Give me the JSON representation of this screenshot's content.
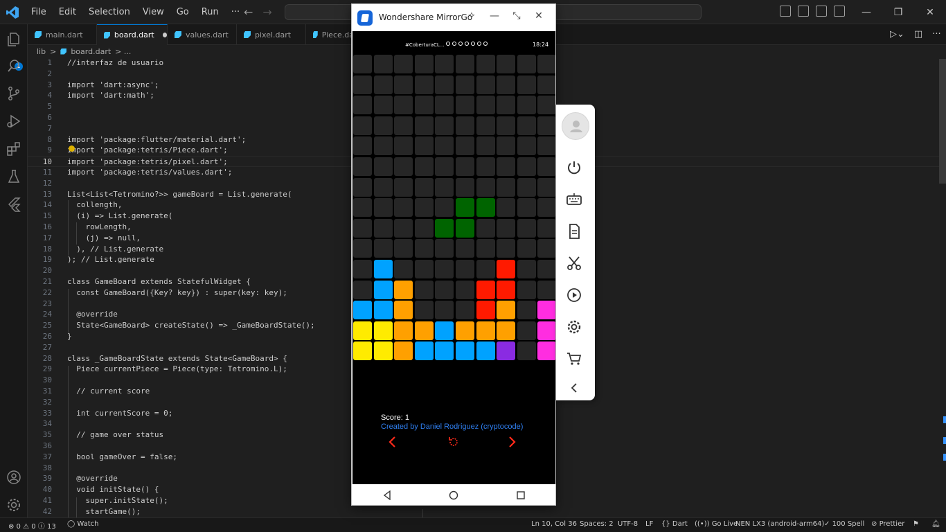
{
  "window": {
    "menu": [
      "File",
      "Edit",
      "Selection",
      "View",
      "Go",
      "Run",
      "···"
    ]
  },
  "activity": {
    "source_control_badge": "1"
  },
  "tabs": [
    {
      "label": "main.dart",
      "active": false
    },
    {
      "label": "board.dart",
      "active": true,
      "modified": true
    },
    {
      "label": "values.dart",
      "active": false
    },
    {
      "label": "pixel.dart",
      "active": false
    },
    {
      "label": "Piece.da",
      "active": false
    }
  ],
  "breadcrumb": {
    "folder": "lib",
    "sep": ">",
    "file": "board.dart",
    "tail": "> ..."
  },
  "editor": {
    "current_line": 10,
    "lines": [
      {
        "n": "1",
        "t": "//interfaz de usuario"
      },
      {
        "n": "2",
        "t": ""
      },
      {
        "n": "3",
        "t": "import 'dart:async';"
      },
      {
        "n": "4",
        "t": "import 'dart:math';"
      },
      {
        "n": "5",
        "t": ""
      },
      {
        "n": "6",
        "t": ""
      },
      {
        "n": "7",
        "t": ""
      },
      {
        "n": "8",
        "t": "import 'package:flutter/material.dart';"
      },
      {
        "n": "9",
        "t": "import 'package:tetris/Piece.dart';"
      },
      {
        "n": "10",
        "t": "import 'package:tetris/pixel.dart';"
      },
      {
        "n": "11",
        "t": "import 'package:tetris/values.dart';"
      },
      {
        "n": "12",
        "t": ""
      },
      {
        "n": "13",
        "t": "List<List<Tetromino?>> gameBoard = List.generate("
      },
      {
        "n": "14",
        "t": "  collength,"
      },
      {
        "n": "15",
        "t": "  (i) => List.generate("
      },
      {
        "n": "16",
        "t": "    rowLength,"
      },
      {
        "n": "17",
        "t": "    (j) => null,"
      },
      {
        "n": "18",
        "t": "  ), // List.generate"
      },
      {
        "n": "19",
        "t": "); // List.generate"
      },
      {
        "n": "20",
        "t": ""
      },
      {
        "n": "21",
        "t": "class GameBoard extends StatefulWidget {"
      },
      {
        "n": "22",
        "t": "  const GameBoard({Key? key}) : super(key: key);"
      },
      {
        "n": "23",
        "t": ""
      },
      {
        "n": "24",
        "t": "  @override"
      },
      {
        "n": "25",
        "t": "  State<GameBoard> createState() => _GameBoardState();"
      },
      {
        "n": "26",
        "t": "}"
      },
      {
        "n": "27",
        "t": ""
      },
      {
        "n": "28",
        "t": "class _GameBoardState extends State<GameBoard> {"
      },
      {
        "n": "29",
        "t": "  Piece currentPiece = Piece(type: Tetromino.L);"
      },
      {
        "n": "30",
        "t": ""
      },
      {
        "n": "31",
        "t": "  // current score"
      },
      {
        "n": "32",
        "t": ""
      },
      {
        "n": "33",
        "t": "  int currentScore = 0;"
      },
      {
        "n": "34",
        "t": ""
      },
      {
        "n": "35",
        "t": "  // game over status"
      },
      {
        "n": "36",
        "t": ""
      },
      {
        "n": "37",
        "t": "  bool gameOver = false;"
      },
      {
        "n": "38",
        "t": ""
      },
      {
        "n": "39",
        "t": "  @override"
      },
      {
        "n": "40",
        "t": "  void initState() {"
      },
      {
        "n": "41",
        "t": "    super.initState();"
      },
      {
        "n": "42",
        "t": "    startGame();"
      }
    ]
  },
  "statusbar": {
    "problems": "⊗ 0 ⚠ 0 ⓘ 13",
    "watch": "Watch",
    "position": "Ln 10, Col 36",
    "spaces": "Spaces: 2",
    "encoding": "UTF-8",
    "eol": "LF",
    "language": "Dart",
    "golive": "Go Live",
    "device": "NEN LX3 (android-arm64)",
    "spell": "100 Spell",
    "prettier": "Prettier"
  },
  "mirrorgo": {
    "title": "Wondershare MirrorGo",
    "phone_status": {
      "carrier": "#CoberturaCL...",
      "time": "18:24"
    },
    "board": {
      "cols": 10,
      "rows": 15,
      "empty_color": "#262626",
      "colors": {
        "G": "#006400",
        "B": "#00a2ff",
        "O": "#ffa000",
        "R": "#ff1a00",
        "Y": "#ffeb00",
        "M": "#ff2de0",
        "P": "#8a2be2"
      },
      "grid": [
        "..........",
        "..........",
        "..........",
        "..........",
        "..........",
        "..........",
        "..........",
        ".....GG...",
        "....GG....",
        "..........",
        ".B.....R..",
        ".BO...RR..",
        "BBO...RO.M",
        "YYOOBOOO.M",
        "YYOBBBBP.M"
      ]
    },
    "score_text": "Score: 1",
    "credit_text": "Created by Daniel Rodriguez (cryptocode)",
    "control_color": "#ff2a1a"
  }
}
